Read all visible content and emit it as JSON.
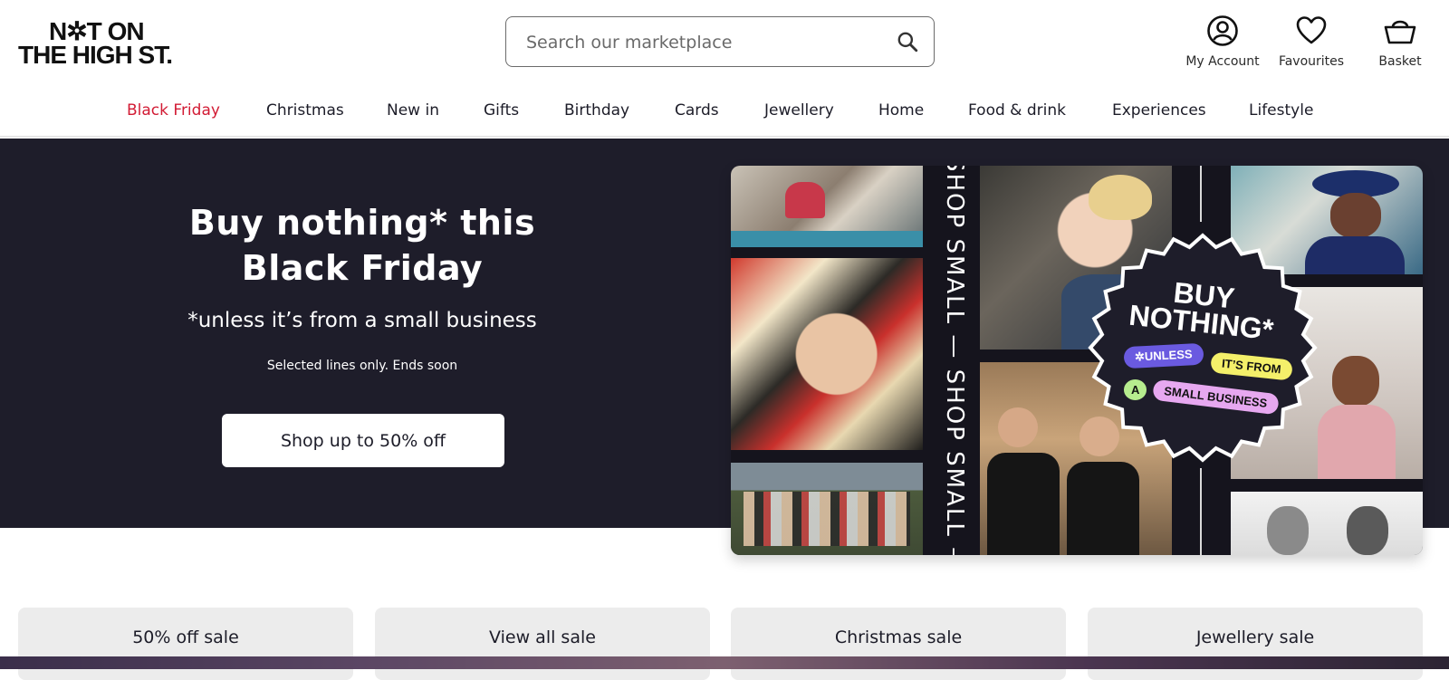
{
  "header": {
    "logo_line1": "N✲T ON",
    "logo_line2": "THE HIGH ST.",
    "search_placeholder": "Search our marketplace",
    "account_label": "My Account",
    "favourites_label": "Favourites",
    "basket_label": "Basket"
  },
  "nav": {
    "items": [
      "Black Friday",
      "Christmas",
      "New in",
      "Gifts",
      "Birthday",
      "Cards",
      "Jewellery",
      "Home",
      "Food & drink",
      "Experiences",
      "Lifestyle"
    ]
  },
  "hero": {
    "title_line1": "Buy nothing* this",
    "title_line2": "Black Friday",
    "subtitle": "*unless it’s from a small business",
    "note": "Selected lines only. Ends soon",
    "button_label": "Shop up to 50% off"
  },
  "collage": {
    "vertical_text": "SHOP SMALL — SHOP SMALL —",
    "seal_line1": "BUY",
    "seal_line2": "NOTHING*",
    "pill_unless": "✲UNLESS",
    "pill_its_from": "IT’S FROM",
    "pill_a": "A",
    "pill_small_business": "SMALL BUSINESS"
  },
  "categories": [
    "50% off sale",
    "View all sale",
    "Christmas sale",
    "Jewellery sale"
  ],
  "colors": {
    "accent_red": "#d21b34",
    "hero_bg": "#1e1d2a",
    "pill_purple": "#6a5ae0",
    "pill_yellow": "#f4f06a",
    "pill_green": "#b6ec8e",
    "pill_pink": "#e7a8f0"
  }
}
